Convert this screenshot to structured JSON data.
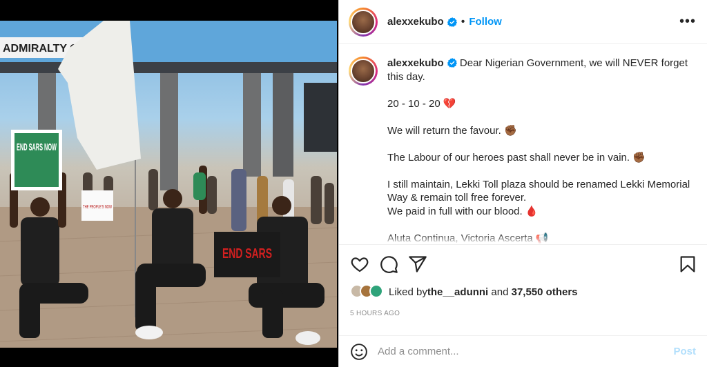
{
  "post": {
    "username": "alexxekubo",
    "follow_label": "Follow",
    "more_label": "•••",
    "dot": "•"
  },
  "photo": {
    "sign_top": "ADMIRALTY CIRCLE",
    "placard_left": "END SARS NOW",
    "placard_mid": "THE PEOPLE'S NOW",
    "placard_center": "END SARS"
  },
  "caption": {
    "username": "alexxekubo",
    "lines": [
      "Dear Nigerian Government, we will NEVER forget this day.",
      "20 - 10 - 20 💔",
      "We will return the favour. ✊🏾",
      "The Labour of our heroes past shall never be in vain. ✊🏾",
      "I still maintain, Lekki Toll plaza should be renamed Lekki Memorial Way & remain toll free forever.",
      "We paid in full with our blood. 🩸",
      "Aluta Continua, Victoria Ascerta 📢"
    ]
  },
  "likes": {
    "prefix": "Liked by ",
    "user": "the__adunni",
    "and": " and ",
    "others": "37,550 others"
  },
  "timestamp": "5 HOURS AGO",
  "comment": {
    "placeholder": "Add a comment...",
    "post_label": "Post"
  },
  "colors": {
    "accent": "#0095f6",
    "verified": "#0095f6",
    "post_disabled": "#b2dffc",
    "muted": "#8e8e8e"
  },
  "icons": {
    "like": "heart-icon",
    "comment": "comment-icon",
    "share": "share-icon",
    "save": "bookmark-icon",
    "emoji": "emoji-icon",
    "verified": "verified-badge-icon",
    "more": "more-options-icon"
  }
}
